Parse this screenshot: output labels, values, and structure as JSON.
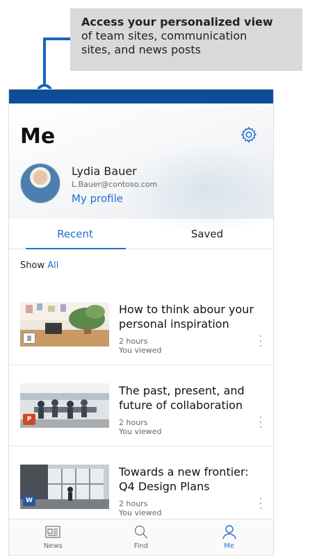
{
  "callout": {
    "title": "Access your personalized view",
    "text_line1": "of team sites, communication",
    "text_line2": "sites, and news posts"
  },
  "header": {
    "title": "Me",
    "settings_icon": "gear-icon"
  },
  "user": {
    "name": "Lydia Bauer",
    "email": "L.Bauer@contoso.com",
    "profile_link": "My profile"
  },
  "tabs": [
    {
      "label": "Recent",
      "active": true
    },
    {
      "label": "Saved",
      "active": false
    }
  ],
  "filter": {
    "prefix": "Show",
    "value": "All"
  },
  "items": [
    {
      "title_line1": "How to think abour your",
      "title_line2": "personal inspiration",
      "time": "2 hours",
      "status": "You viewed",
      "type_icon": "news-icon",
      "badge": "≣"
    },
    {
      "title_line1": "The past, present, and",
      "title_line2": "future of collaboration",
      "time": "2 hours",
      "status": "You viewed",
      "type_icon": "powerpoint-icon",
      "badge": "P"
    },
    {
      "title_line1": "Towards a new frontier:",
      "title_line2": "Q4 Design Plans",
      "time": "2 hours",
      "status": "You viewed",
      "type_icon": "word-icon",
      "badge": "W"
    }
  ],
  "bottom_nav": [
    {
      "label": "News",
      "icon": "news-icon",
      "active": false
    },
    {
      "label": "Find",
      "icon": "search-icon",
      "active": false
    },
    {
      "label": "Me",
      "icon": "person-icon",
      "active": true
    }
  ],
  "colors": {
    "accent": "#1f6fd0",
    "topbar": "#0f4c97",
    "callout_bg": "#d9d9d9",
    "powerpoint": "#d24726",
    "word": "#2b579a"
  }
}
